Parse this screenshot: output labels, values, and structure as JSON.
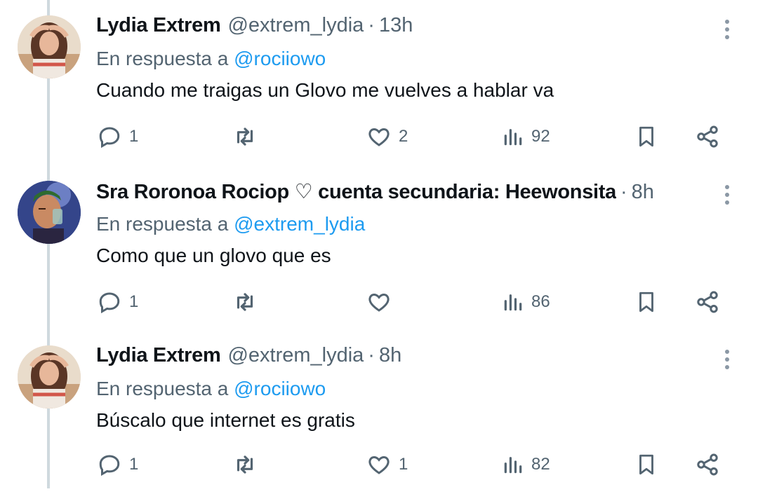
{
  "reply_prefix": "En respuesta a",
  "tweets": [
    {
      "name": "Lydia Extrem",
      "handle": "@extrem_lydia",
      "dot": "·",
      "time": "13h",
      "reply_to": "@rociiowo",
      "text": "Cuando me traigas un Glovo me vuelves a hablar va",
      "replies": "1",
      "retweets": "",
      "likes": "2",
      "views": "92"
    },
    {
      "name": "Sra Roronoa Rociop ♡ cuenta secundaria: Heewonsita",
      "handle": "",
      "dot": "·",
      "time": "8h",
      "reply_to": "@extrem_lydia",
      "text": "Como que un glovo que es",
      "replies": "1",
      "retweets": "",
      "likes": "",
      "views": "86"
    },
    {
      "name": "Lydia Extrem",
      "handle": "@extrem_lydia",
      "dot": "·",
      "time": "8h",
      "reply_to": "@rociiowo",
      "text": "Búscalo que internet es gratis",
      "replies": "1",
      "retweets": "",
      "likes": "1",
      "views": "82"
    }
  ],
  "colors": {
    "text_primary": "#0f1419",
    "text_secondary": "#536471",
    "link": "#1d9bf0",
    "thread_line": "#cfd9de"
  },
  "icons": [
    "reply-icon",
    "retweet-icon",
    "like-icon",
    "views-icon",
    "bookmark-icon",
    "share-icon",
    "more-icon"
  ]
}
